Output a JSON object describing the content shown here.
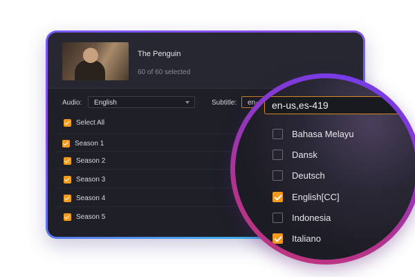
{
  "media": {
    "title": "The Penguin",
    "selected_count": "60 of 60 selected"
  },
  "audio": {
    "label": "Audio:",
    "value": "English"
  },
  "subtitle": {
    "label": "Subtitle:",
    "value_truncated": "en-",
    "value": "en-us,es-419"
  },
  "select_all": {
    "label": "Select All",
    "checked": true
  },
  "seasons": [
    {
      "label": "Season 1",
      "checked": true
    },
    {
      "label": "Season 2",
      "checked": true
    },
    {
      "label": "Season 3",
      "checked": true
    },
    {
      "label": "Season 4",
      "checked": true
    },
    {
      "label": "Season 5",
      "checked": true
    }
  ],
  "subtitle_options": [
    {
      "label": "Bahasa Melayu",
      "checked": false
    },
    {
      "label": "Dansk",
      "checked": false
    },
    {
      "label": "Deutsch",
      "checked": false
    },
    {
      "label": "English[CC]",
      "checked": true
    },
    {
      "label": "Indonesia",
      "checked": false
    },
    {
      "label": "Italiano",
      "checked": true
    }
  ],
  "colors": {
    "accent": "#f39a1e",
    "window_bg": "#1e1f27"
  }
}
